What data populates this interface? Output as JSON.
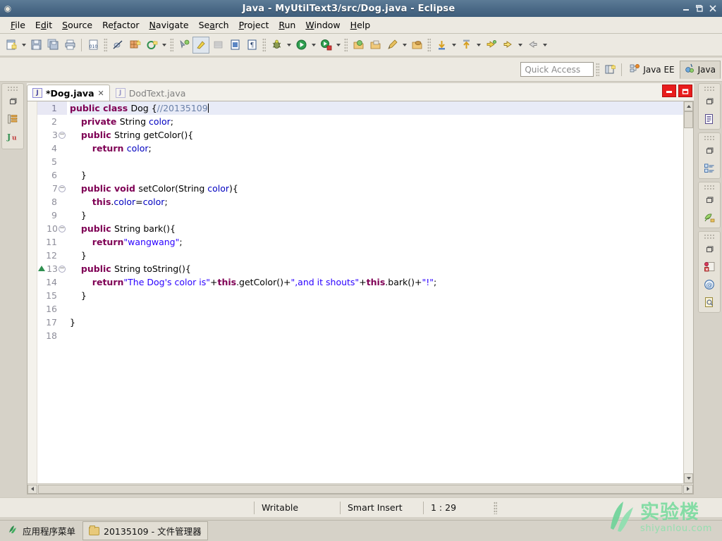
{
  "window": {
    "title": "Java - MyUtilText3/src/Dog.java - Eclipse",
    "app_icon": "eclipse-icon",
    "minimize": "minimize-icon",
    "maximize": "maximize-icon",
    "close": "close-icon"
  },
  "menubar": {
    "items": [
      {
        "label": "File",
        "mnemonic": "F"
      },
      {
        "label": "Edit",
        "mnemonic": "E"
      },
      {
        "label": "Source",
        "mnemonic": "S"
      },
      {
        "label": "Refactor",
        "mnemonic": "f"
      },
      {
        "label": "Navigate",
        "mnemonic": "N"
      },
      {
        "label": "Search",
        "mnemonic": "a"
      },
      {
        "label": "Project",
        "mnemonic": "P"
      },
      {
        "label": "Run",
        "mnemonic": "R"
      },
      {
        "label": "Window",
        "mnemonic": "W"
      },
      {
        "label": "Help",
        "mnemonic": "H"
      }
    ]
  },
  "toolbar": {
    "items": [
      {
        "name": "new-wizard-icon",
        "tip": "New"
      },
      {
        "name": "new-dropdown-arrow",
        "tip": "New menu"
      },
      {
        "name": "save-icon",
        "tip": "Save"
      },
      {
        "name": "save-all-icon",
        "tip": "Save All"
      },
      {
        "name": "print-icon",
        "tip": "Print"
      },
      {
        "name": "separator",
        "tip": ""
      },
      {
        "name": "toggle-binary-icon",
        "tip": "010"
      },
      {
        "name": "dots-handle",
        "tip": ""
      },
      {
        "name": "toggle-breakpoint-icon",
        "tip": "Skip All Breakpoints"
      },
      {
        "name": "new-java-package-icon",
        "tip": "New Java Package"
      },
      {
        "name": "new-java-class-icon",
        "tip": "New Java Class"
      },
      {
        "name": "new-class-dropdown-arrow",
        "tip": ""
      },
      {
        "name": "debug-icon",
        "tip": "Debug"
      },
      {
        "name": "toggle-mark-occurrences-icon",
        "tip": "Toggle Mark Occurrences"
      },
      {
        "name": "show-whitespace-icon",
        "tip": "Show Whitespace Characters"
      },
      {
        "name": "toggle-block-selection-icon",
        "tip": "Toggle Block Selection"
      },
      {
        "name": "show-print-margin-icon",
        "tip": "Show Print Margin"
      },
      {
        "name": "dots-handle-2",
        "tip": ""
      },
      {
        "name": "debug-bug-icon",
        "tip": "Debug"
      },
      {
        "name": "debug-dropdown-arrow",
        "tip": ""
      },
      {
        "name": "run-icon",
        "tip": "Run"
      },
      {
        "name": "run-dropdown-arrow",
        "tip": ""
      },
      {
        "name": "run-coverage-icon",
        "tip": "Coverage"
      },
      {
        "name": "coverage-dropdown-arrow",
        "tip": ""
      },
      {
        "name": "dots-handle-3",
        "tip": ""
      },
      {
        "name": "open-type-icon",
        "tip": "Open Type"
      },
      {
        "name": "open-task-icon",
        "tip": "Open Task"
      },
      {
        "name": "search-pencil-icon",
        "tip": "Search"
      },
      {
        "name": "search-dropdown-arrow",
        "tip": ""
      },
      {
        "name": "open-resource-icon",
        "tip": "Open Resource"
      },
      {
        "name": "dots-handle-4",
        "tip": ""
      },
      {
        "name": "next-annotation-icon",
        "tip": "Next Annotation"
      },
      {
        "name": "next-annotation-arrow",
        "tip": ""
      },
      {
        "name": "previous-annotation-icon",
        "tip": "Previous Annotation"
      },
      {
        "name": "previous-annotation-arrow",
        "tip": ""
      },
      {
        "name": "last-edit-location-icon",
        "tip": "Last Edit Location"
      },
      {
        "name": "back-icon",
        "tip": "Back"
      },
      {
        "name": "back-dropdown-arrow",
        "tip": ""
      },
      {
        "name": "forward-icon",
        "tip": "Forward"
      },
      {
        "name": "forward-dropdown-arrow",
        "tip": ""
      }
    ]
  },
  "quick_access": {
    "placeholder": "Quick Access"
  },
  "perspectives": {
    "open_perspective_icon": "open-perspective-icon",
    "items": [
      {
        "label": "Java EE",
        "icon": "java-ee-perspective-icon",
        "active": false
      },
      {
        "label": "Java",
        "icon": "java-perspective-icon",
        "active": true
      }
    ]
  },
  "left_trim": {
    "items": [
      {
        "name": "restore-icon",
        "label": ""
      },
      {
        "name": "package-explorer-icon",
        "label": ""
      },
      {
        "name": "junit-icon",
        "label": "Ju"
      }
    ]
  },
  "right_trim": {
    "groups": [
      {
        "items": [
          {
            "name": "restore-icon",
            "label": ""
          },
          {
            "name": "outline-view-icon",
            "label": ""
          }
        ]
      },
      {
        "items": [
          {
            "name": "restore-icon",
            "label": ""
          },
          {
            "name": "task-list-view-icon",
            "label": ""
          }
        ]
      },
      {
        "items": [
          {
            "name": "restore-icon",
            "label": ""
          },
          {
            "name": "servers-view-icon",
            "label": ""
          }
        ]
      },
      {
        "items": [
          {
            "name": "restore-icon",
            "label": ""
          },
          {
            "name": "problems-view-icon",
            "label": ""
          },
          {
            "name": "javadoc-view-icon",
            "label": ""
          },
          {
            "name": "declaration-view-icon",
            "label": ""
          }
        ]
      }
    ]
  },
  "editor": {
    "tabs": [
      {
        "label": "*Dog.java",
        "active": true,
        "dirty": true,
        "closeable": true,
        "close_glyph": "✕"
      },
      {
        "label": "DodText.java",
        "active": false,
        "dirty": false,
        "closeable": false,
        "close_glyph": ""
      }
    ],
    "controls": [
      {
        "name": "minimize-editor-button",
        "glyph": "minimize-icon"
      },
      {
        "name": "maximize-editor-button",
        "glyph": "maximize-icon"
      }
    ],
    "file_icon_letter": "J",
    "current_line": 1,
    "lines": [
      {
        "num": "1",
        "fold": false,
        "override": false,
        "current": true,
        "tokens": [
          {
            "t": "public ",
            "c": "kw"
          },
          {
            "t": "class ",
            "c": "kw"
          },
          {
            "t": "Dog {",
            "c": "plain"
          },
          {
            "t": "//20135109",
            "c": "cmt"
          }
        ]
      },
      {
        "num": "2",
        "fold": false,
        "override": false,
        "current": false,
        "tokens": [
          {
            "t": "    ",
            "c": "plain"
          },
          {
            "t": "private ",
            "c": "kw"
          },
          {
            "t": "String ",
            "c": "plain"
          },
          {
            "t": "color",
            "c": "fld"
          },
          {
            "t": ";",
            "c": "plain"
          }
        ]
      },
      {
        "num": "3",
        "fold": true,
        "override": false,
        "current": false,
        "tokens": [
          {
            "t": "    ",
            "c": "plain"
          },
          {
            "t": "public ",
            "c": "kw"
          },
          {
            "t": "String getColor(){",
            "c": "plain"
          }
        ]
      },
      {
        "num": "4",
        "fold": false,
        "override": false,
        "current": false,
        "tokens": [
          {
            "t": "        ",
            "c": "plain"
          },
          {
            "t": "return ",
            "c": "kw"
          },
          {
            "t": "color",
            "c": "fld"
          },
          {
            "t": ";",
            "c": "plain"
          }
        ]
      },
      {
        "num": "5",
        "fold": false,
        "override": false,
        "current": false,
        "tokens": []
      },
      {
        "num": "6",
        "fold": false,
        "override": false,
        "current": false,
        "tokens": [
          {
            "t": "    }",
            "c": "plain"
          }
        ]
      },
      {
        "num": "7",
        "fold": true,
        "override": false,
        "current": false,
        "tokens": [
          {
            "t": "    ",
            "c": "plain"
          },
          {
            "t": "public void ",
            "c": "kw"
          },
          {
            "t": "setColor(String ",
            "c": "plain"
          },
          {
            "t": "color",
            "c": "fld"
          },
          {
            "t": "){",
            "c": "plain"
          }
        ]
      },
      {
        "num": "8",
        "fold": false,
        "override": false,
        "current": false,
        "tokens": [
          {
            "t": "        ",
            "c": "plain"
          },
          {
            "t": "this",
            "c": "kw"
          },
          {
            "t": ".",
            "c": "plain"
          },
          {
            "t": "color",
            "c": "fld"
          },
          {
            "t": "=",
            "c": "plain"
          },
          {
            "t": "color",
            "c": "fld"
          },
          {
            "t": ";",
            "c": "plain"
          }
        ]
      },
      {
        "num": "9",
        "fold": false,
        "override": false,
        "current": false,
        "tokens": [
          {
            "t": "    }",
            "c": "plain"
          }
        ]
      },
      {
        "num": "10",
        "fold": true,
        "override": false,
        "current": false,
        "tokens": [
          {
            "t": "    ",
            "c": "plain"
          },
          {
            "t": "public ",
            "c": "kw"
          },
          {
            "t": "String bark(){",
            "c": "plain"
          }
        ]
      },
      {
        "num": "11",
        "fold": false,
        "override": false,
        "current": false,
        "tokens": [
          {
            "t": "        ",
            "c": "plain"
          },
          {
            "t": "return",
            "c": "kw"
          },
          {
            "t": "\"wangwang\"",
            "c": "str"
          },
          {
            "t": ";",
            "c": "plain"
          }
        ]
      },
      {
        "num": "12",
        "fold": false,
        "override": false,
        "current": false,
        "tokens": [
          {
            "t": "    }",
            "c": "plain"
          }
        ]
      },
      {
        "num": "13",
        "fold": true,
        "override": true,
        "current": false,
        "tokens": [
          {
            "t": "    ",
            "c": "plain"
          },
          {
            "t": "public ",
            "c": "kw"
          },
          {
            "t": "String toString(){",
            "c": "plain"
          }
        ]
      },
      {
        "num": "14",
        "fold": false,
        "override": false,
        "current": false,
        "tokens": [
          {
            "t": "        ",
            "c": "plain"
          },
          {
            "t": "return",
            "c": "kw"
          },
          {
            "t": "\"The Dog's color is\"",
            "c": "str"
          },
          {
            "t": "+",
            "c": "plain"
          },
          {
            "t": "this",
            "c": "kw"
          },
          {
            "t": ".getColor()+",
            "c": "plain"
          },
          {
            "t": "\",and it shouts\"",
            "c": "str"
          },
          {
            "t": "+",
            "c": "plain"
          },
          {
            "t": "this",
            "c": "kw"
          },
          {
            "t": ".bark()+",
            "c": "plain"
          },
          {
            "t": "\"!\"",
            "c": "str"
          },
          {
            "t": ";",
            "c": "plain"
          }
        ]
      },
      {
        "num": "15",
        "fold": false,
        "override": false,
        "current": false,
        "tokens": [
          {
            "t": "    }",
            "c": "plain"
          }
        ]
      },
      {
        "num": "16",
        "fold": false,
        "override": false,
        "current": false,
        "tokens": []
      },
      {
        "num": "17",
        "fold": false,
        "override": false,
        "current": false,
        "tokens": [
          {
            "t": "}",
            "c": "plain"
          }
        ]
      },
      {
        "num": "18",
        "fold": false,
        "override": false,
        "current": false,
        "tokens": []
      }
    ],
    "scrollbars": {
      "v_up": "scroll-up-arrow",
      "v_down": "scroll-down-arrow",
      "h_left": "◄",
      "h_right": "►"
    }
  },
  "statusbar": {
    "writable": "Writable",
    "insert_mode": "Smart Insert",
    "cursor_position": "1 : 29"
  },
  "taskbar": {
    "app_menu": "应用程序菜单",
    "tasks": [
      {
        "label": "20135109 - 文件管理器",
        "icon": "folder-icon"
      }
    ]
  },
  "watermark": {
    "cn": "实验楼",
    "en": "shiyanlou.com",
    "color": "#7ddba0"
  }
}
